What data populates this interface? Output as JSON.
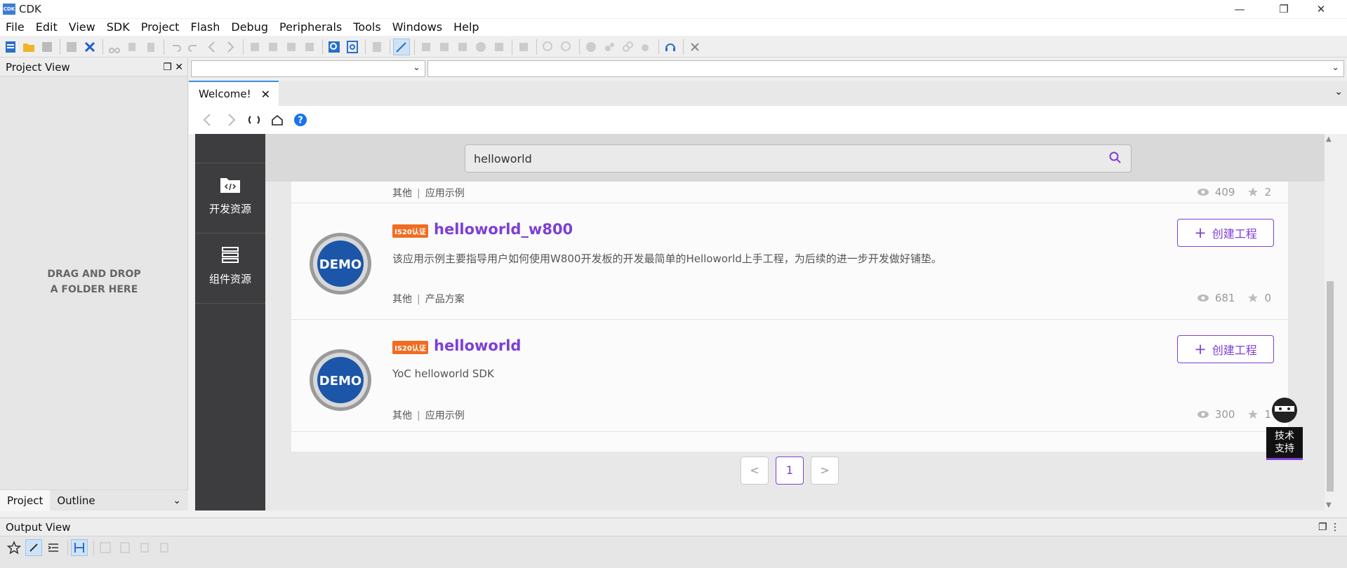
{
  "window": {
    "title": "CDK",
    "logo_text": "CDK",
    "minimize": "—",
    "maximize": "❐",
    "close": "✕"
  },
  "menu": [
    "File",
    "Edit",
    "View",
    "SDK",
    "Project",
    "Flash",
    "Debug",
    "Peripherals",
    "Tools",
    "Windows",
    "Help"
  ],
  "project_view": {
    "title": "Project View",
    "drop_line1": "DRAG AND DROP",
    "drop_line2": "A FOLDER HERE",
    "tabs": [
      "Project",
      "Outline"
    ]
  },
  "editor": {
    "tab_label": "Welcome!",
    "close_glyph": "✕"
  },
  "web": {
    "sidebar": [
      {
        "label": "开发资源",
        "icon": "code-folder-icon"
      },
      {
        "label": "组件资源",
        "icon": "component-list-icon"
      }
    ],
    "search": {
      "value": "helloworld",
      "placeholder": ""
    },
    "previous_row": {
      "tag1": "其他",
      "tag2": "应用示例",
      "views": "409",
      "stars": "2"
    },
    "cards": [
      {
        "badge": "IS20认证",
        "title": "helloworld_w800",
        "desc": "该应用示例主要指导用户如何使用W800开发板的开发最简单的Helloworld上手工程，为后续的进一步开发做好铺垫。",
        "tag1": "其他",
        "tag2": "产品方案",
        "views": "681",
        "stars": "0",
        "button": "创建工程"
      },
      {
        "badge": "IS20认证",
        "title": "helloworld",
        "desc": "YoC helloworld SDK",
        "tag1": "其他",
        "tag2": "应用示例",
        "views": "300",
        "stars": "1",
        "button": "创建工程"
      }
    ],
    "pagination": {
      "prev": "<",
      "current": "1",
      "next": ">"
    },
    "support": {
      "line1": "技术",
      "line2": "支持"
    },
    "demo_logo_text": "DEMO"
  },
  "output_view": {
    "title": "Output View"
  },
  "colors": {
    "accent": "#7d3fd6",
    "badge": "#ef6c21",
    "sidebar": "#3d3d3f",
    "tab_accent": "#3c8fd6"
  }
}
